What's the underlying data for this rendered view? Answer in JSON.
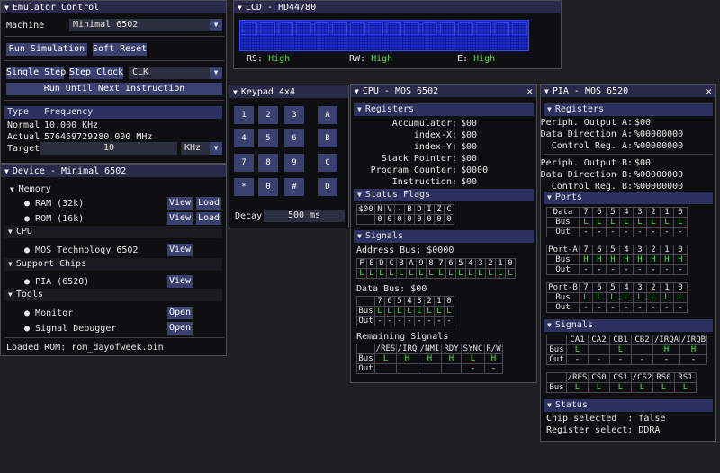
{
  "emu": {
    "title": "Emulator Control",
    "machine_label": "Machine",
    "machine_value": "Minimal 6502",
    "run_sim": "Run Simulation",
    "soft_reset": "Soft Reset",
    "single_step": "Single Step",
    "step_clock": "Step Clock",
    "clk_value": "CLK",
    "run_until": "Run Until Next Instruction",
    "type_h": "Type",
    "freq_h": "Frequency",
    "normal_l": "Normal",
    "normal_v": "10.000 KHz",
    "actual_l": "Actual",
    "actual_v": "576469729280.000 MHz",
    "target_l": "Target",
    "target_v": "10",
    "unit_v": "KHz"
  },
  "device": {
    "title": "Device - Minimal 6502",
    "memory": "Memory",
    "ram": "RAM (32k)",
    "rom": "ROM (16k)",
    "cpu": "CPU",
    "cpu_item": "MOS Technology 6502",
    "support": "Support Chips",
    "pia": "PIA (6520)",
    "tools": "Tools",
    "monitor": "Monitor",
    "sigdbg": "Signal Debugger",
    "view": "View",
    "load": "Load",
    "open": "Open",
    "loaded": "Loaded ROM: rom_dayofweek.bin"
  },
  "lcd": {
    "title": "LCD - HD44780",
    "rs_l": "RS:",
    "rs_v": "High",
    "rw_l": "RW:",
    "rw_v": "High",
    "e_l": "E:",
    "e_v": "High"
  },
  "keypad": {
    "title": "Keypad 4x4",
    "keys": [
      "1",
      "2",
      "3",
      "A",
      "4",
      "5",
      "6",
      "B",
      "7",
      "8",
      "9",
      "C",
      "*",
      "0",
      "#",
      "D"
    ],
    "decay_l": "Decay",
    "decay_v": "500 ms"
  },
  "cpu": {
    "title": "CPU - MOS 6502",
    "registers": "Registers",
    "acc_l": "Accumulator:",
    "acc_v": "$00",
    "ix_l": "index-X:",
    "ix_v": "$00",
    "iy_l": "index-Y:",
    "iy_v": "$00",
    "sp_l": "Stack Pointer:",
    "sp_v": "$00",
    "pc_l": "Program Counter:",
    "pc_v": "$0000",
    "in_l": "Instruction:",
    "in_v": "$00",
    "flags": "Status Flags",
    "flag_hdr": [
      "$00",
      "N",
      "V",
      "-",
      "B",
      "D",
      "I",
      "Z",
      "C"
    ],
    "flag_vals": [
      "",
      "0",
      "0",
      "0",
      "0",
      "0",
      "0",
      "0",
      "0"
    ],
    "signals": "Signals",
    "addr_bus": "Address Bus: $0000",
    "addr_hdr": [
      "F",
      "E",
      "D",
      "C",
      "B",
      "A",
      "9",
      "8",
      "7",
      "6",
      "5",
      "4",
      "3",
      "2",
      "1",
      "0"
    ],
    "addr_vals": [
      "L",
      "L",
      "L",
      "L",
      "L",
      "L",
      "L",
      "L",
      "L",
      "L",
      "L",
      "L",
      "L",
      "L",
      "L",
      "L"
    ],
    "data_bus": "Data Bus: $00",
    "dbits": [
      "7",
      "6",
      "5",
      "4",
      "3",
      "2",
      "1",
      "0"
    ],
    "bus_l": "Bus",
    "out_l": "Out",
    "dbus_vals": [
      "L",
      "L",
      "L",
      "L",
      "L",
      "L",
      "L",
      "L"
    ],
    "dout_vals": [
      "-",
      "-",
      "-",
      "-",
      "-",
      "-",
      "-",
      "-"
    ],
    "remaining": "Remaining Signals",
    "rem_hdr": [
      "/RES",
      "/IRQ",
      "/NMI",
      "RDY",
      "SYNC",
      "R/W"
    ],
    "rem_bus": [
      "L",
      "H",
      "H",
      "H",
      "L",
      "H"
    ],
    "rem_out": [
      "",
      "",
      "",
      "",
      "-",
      "-"
    ]
  },
  "pia": {
    "title": "PIA - MOS 6520",
    "registers": "Registers",
    "poa_l": "Periph. Output A:",
    "poa_v": "$00",
    "dda_l": "Data Direction A:",
    "dda_v": "%00000000",
    "cra_l": "Control Reg. A:",
    "cra_v": "%00000000",
    "pob_l": "Periph. Output B:",
    "pob_v": "$00",
    "ddb_l": "Data Direction B:",
    "ddb_v": "%00000000",
    "crb_l": "Control Reg. B:",
    "crb_v": "%00000000",
    "ports": "Ports",
    "bits": [
      "7",
      "6",
      "5",
      "4",
      "3",
      "2",
      "1",
      "0"
    ],
    "data_l": "Data",
    "porta_l": "Port-A",
    "portb_l": "Port-B",
    "bus_l": "Bus",
    "out_l": "Out",
    "data_bus": [
      "L",
      "L",
      "L",
      "L",
      "L",
      "L",
      "L",
      "L"
    ],
    "data_out": [
      "-",
      "-",
      "-",
      "-",
      "-",
      "-",
      "-",
      "-"
    ],
    "pa_bus": [
      "H",
      "H",
      "H",
      "H",
      "H",
      "H",
      "H",
      "H"
    ],
    "pa_out": [
      "-",
      "-",
      "-",
      "-",
      "-",
      "-",
      "-",
      "-"
    ],
    "pb_bus": [
      "L",
      "L",
      "L",
      "L",
      "L",
      "L",
      "L",
      "L"
    ],
    "pb_out": [
      "-",
      "-",
      "-",
      "-",
      "-",
      "-",
      "-",
      "-"
    ],
    "signals": "Signals",
    "sig1_hdr": [
      "CA1",
      "CA2",
      "CB1",
      "CB2",
      "/IRQA",
      "/IRQB"
    ],
    "sig1_bus": [
      "L",
      "",
      "L",
      "",
      "H",
      "H"
    ],
    "sig1_out": [
      "-",
      "-",
      "-",
      "-",
      "-",
      "-"
    ],
    "sig2_hdr": [
      "/RES",
      "CS0",
      "CS1",
      "/CS2",
      "RS0",
      "RS1"
    ],
    "sig2_bus": [
      "L",
      "L",
      "L",
      "L",
      "L",
      "L"
    ],
    "status": "Status",
    "chip_sel": "Chip selected  : false",
    "reg_sel": "Register select: DDRA"
  }
}
